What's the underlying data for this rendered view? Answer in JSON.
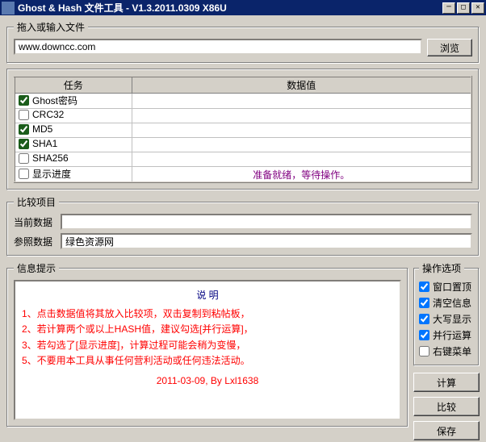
{
  "window": {
    "title": "Ghost & Hash 文件工具 - V1.3.2011.0309 X86U"
  },
  "fileGroup": {
    "legend": "拖入或输入文件",
    "path": "www.downcc.com",
    "browse": "浏览"
  },
  "tasks": {
    "colTask": "任务",
    "colValue": "数据值",
    "rows": [
      {
        "label": "Ghost密码",
        "checked": true,
        "value": ""
      },
      {
        "label": "CRC32",
        "checked": false,
        "value": ""
      },
      {
        "label": "MD5",
        "checked": true,
        "value": ""
      },
      {
        "label": "SHA1",
        "checked": true,
        "value": ""
      },
      {
        "label": "SHA256",
        "checked": false,
        "value": ""
      },
      {
        "label": "显示进度",
        "checked": false,
        "value": "准备就绪，等待操作。",
        "status": true
      }
    ]
  },
  "compare": {
    "legend": "比较项目",
    "currentLabel": "当前数据",
    "currentValue": "",
    "refLabel": "参照数据",
    "refValue": "绿色资源网"
  },
  "info": {
    "legend": "信息提示",
    "heading": "说 明",
    "lines": [
      "1、点击数据值将其放入比较项，双击复制到粘帖板，",
      "2、若计算两个或以上HASH值，建议勾选[并行运算]，",
      "3、若勾选了[显示进度]，计算过程可能会稍为变慢，",
      "5、不要用本工具从事任何营利活动或任何违法活动。"
    ],
    "footer": "2011-03-09, By Lxl1638"
  },
  "options": {
    "legend": "操作选项",
    "items": [
      {
        "label": "窗口置顶",
        "checked": true
      },
      {
        "label": "清空信息",
        "checked": true
      },
      {
        "label": "大写显示",
        "checked": true
      },
      {
        "label": "并行运算",
        "checked": true
      },
      {
        "label": "右键菜单",
        "checked": false
      }
    ]
  },
  "buttons": {
    "calc": "计算",
    "compare": "比较",
    "save": "保存"
  }
}
